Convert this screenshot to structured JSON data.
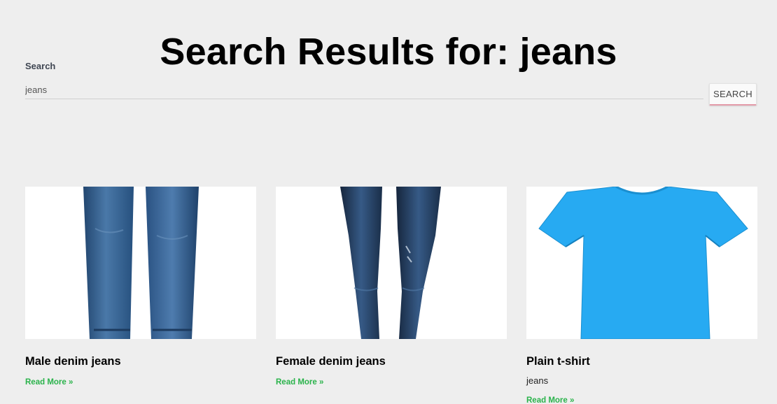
{
  "page_title": "Search Results for: jeans",
  "search": {
    "label": "Search",
    "value": "jeans",
    "button_label": "SEARCH"
  },
  "results": [
    {
      "title": "Male denim jeans",
      "excerpt": "",
      "read_more": "Read More »",
      "image_icon": "male-jeans-image"
    },
    {
      "title": "Female denim jeans",
      "excerpt": "",
      "read_more": "Read More »",
      "image_icon": "female-jeans-image"
    },
    {
      "title": "Plain t-shirt",
      "excerpt": "jeans",
      "read_more": "Read More »",
      "image_icon": "tshirt-image"
    }
  ],
  "colors": {
    "background": "#eeeeee",
    "read_more": "#2ab34b",
    "tshirt": "#27aaf2",
    "denim_male": "#2f5684",
    "denim_female": "#1f3553"
  }
}
